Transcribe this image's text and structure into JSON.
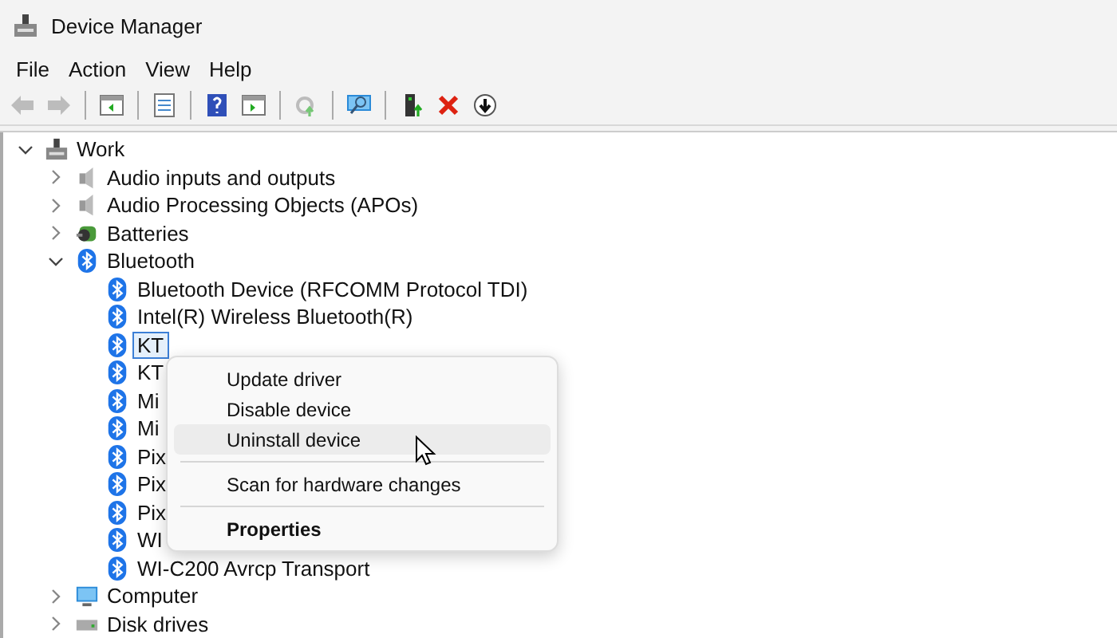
{
  "window": {
    "title": "Device Manager"
  },
  "menu_bar": [
    "File",
    "Action",
    "View",
    "Help"
  ],
  "toolbar": [
    {
      "kind": "back",
      "disabled": true
    },
    {
      "kind": "forward",
      "disabled": true
    },
    {
      "kind": "sep"
    },
    {
      "kind": "panel",
      "disabled": false
    },
    {
      "kind": "sep"
    },
    {
      "kind": "list",
      "disabled": false
    },
    {
      "kind": "sep"
    },
    {
      "kind": "help",
      "disabled": false
    },
    {
      "kind": "run",
      "disabled": false
    },
    {
      "kind": "sep"
    },
    {
      "kind": "gear-up",
      "disabled": true
    },
    {
      "kind": "sep"
    },
    {
      "kind": "scan",
      "disabled": false
    },
    {
      "kind": "sep"
    },
    {
      "kind": "device-up",
      "disabled": false
    },
    {
      "kind": "remove",
      "disabled": false
    },
    {
      "kind": "down",
      "disabled": false
    }
  ],
  "tree": [
    {
      "label": "Work",
      "kind": "computer",
      "expanded": true,
      "selected": false,
      "children": [
        {
          "label": "Audio inputs and outputs",
          "kind": "audio",
          "expanded": false,
          "selected": false
        },
        {
          "label": "Audio Processing Objects (APOs)",
          "kind": "audio",
          "expanded": false,
          "selected": false
        },
        {
          "label": "Batteries",
          "kind": "battery",
          "expanded": false,
          "selected": false
        },
        {
          "label": "Bluetooth",
          "kind": "bluetooth",
          "expanded": true,
          "selected": false,
          "children": [
            {
              "label": "Bluetooth Device (RFCOMM Protocol TDI)",
              "kind": "bluetooth",
              "selected": false
            },
            {
              "label": "Intel(R) Wireless Bluetooth(R)",
              "kind": "bluetooth",
              "selected": false
            },
            {
              "label": "KT",
              "kind": "bluetooth",
              "selected": true
            },
            {
              "label": "KT",
              "kind": "bluetooth",
              "selected": false
            },
            {
              "label": "Mi",
              "kind": "bluetooth",
              "selected": false
            },
            {
              "label": "Mi",
              "kind": "bluetooth",
              "selected": false
            },
            {
              "label": "Pix",
              "kind": "bluetooth",
              "selected": false
            },
            {
              "label": "Pix",
              "kind": "bluetooth",
              "selected": false
            },
            {
              "label": "Pix",
              "kind": "bluetooth",
              "selected": false
            },
            {
              "label": "WI",
              "kind": "bluetooth",
              "selected": false
            },
            {
              "label": "WI-C200 Avrcp Transport",
              "kind": "bluetooth",
              "selected": false
            }
          ]
        },
        {
          "label": "Computer",
          "kind": "monitor",
          "expanded": false,
          "selected": false
        },
        {
          "label": "Disk drives",
          "kind": "disk",
          "expanded": false,
          "selected": false
        }
      ]
    }
  ],
  "context_menu": [
    {
      "kind": "item",
      "label": "Update driver",
      "highlighted": false,
      "default": false
    },
    {
      "kind": "item",
      "label": "Disable device",
      "highlighted": false,
      "default": false
    },
    {
      "kind": "item",
      "label": "Uninstall device",
      "highlighted": true,
      "default": false
    },
    {
      "kind": "separator"
    },
    {
      "kind": "item",
      "label": "Scan for hardware changes",
      "highlighted": false,
      "default": false
    },
    {
      "kind": "separator"
    },
    {
      "kind": "item",
      "label": "Properties",
      "highlighted": false,
      "default": true
    }
  ]
}
